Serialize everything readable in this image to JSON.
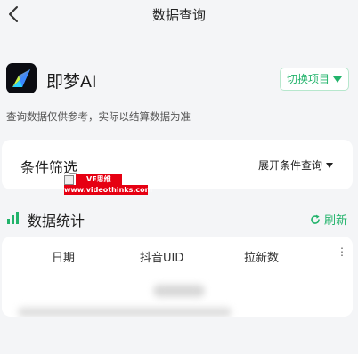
{
  "header": {
    "title": "数据查询"
  },
  "app": {
    "name": "即梦AI",
    "switch_label": "切换项目"
  },
  "disclaimer": "查询数据仅供参考，实际以结算数据为准",
  "filter": {
    "title": "条件筛选",
    "expand_label": "展开条件查询"
  },
  "watermark": {
    "badge": "VE思维",
    "url": "www.videothinks.com"
  },
  "stats": {
    "title": "数据统计",
    "refresh_label": "刷新",
    "columns": [
      "日期",
      "抖音UID",
      "拉新数"
    ],
    "more_glyph": "⋮"
  },
  "colors": {
    "accent": "#22b36b",
    "watermark_red": "#e60012",
    "background": "#f4f5f7"
  }
}
